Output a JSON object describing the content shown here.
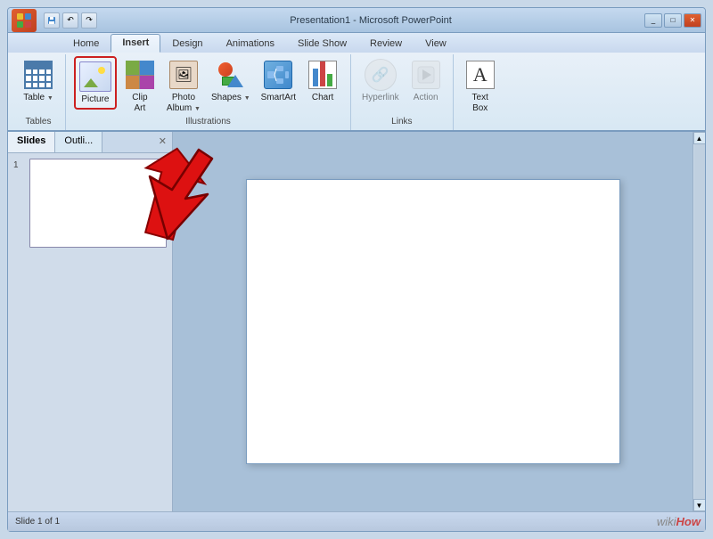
{
  "app": {
    "title": "Microsoft PowerPoint",
    "doc_title": "Presentation1 - Microsoft PowerPoint"
  },
  "title_bar": {
    "save_label": "💾",
    "undo_label": "↶",
    "redo_label": "↷"
  },
  "ribbon": {
    "tabs": [
      {
        "id": "home",
        "label": "Home"
      },
      {
        "id": "insert",
        "label": "Insert",
        "active": true
      },
      {
        "id": "design",
        "label": "Design"
      },
      {
        "id": "animations",
        "label": "Animations"
      },
      {
        "id": "slideshow",
        "label": "Slide Show"
      },
      {
        "id": "review",
        "label": "Review"
      },
      {
        "id": "view",
        "label": "View"
      }
    ],
    "groups": [
      {
        "id": "tables",
        "label": "Tables",
        "items": [
          {
            "id": "table",
            "label": "Table",
            "has_arrow": true
          }
        ]
      },
      {
        "id": "illustrations",
        "label": "Illustrations",
        "items": [
          {
            "id": "picture",
            "label": "Picture",
            "highlighted": true
          },
          {
            "id": "clip-art",
            "label": "Clip\nArt"
          },
          {
            "id": "photo-album",
            "label": "Photo\nAlbum",
            "has_arrow": true
          },
          {
            "id": "shapes",
            "label": "Shapes",
            "has_arrow": true
          },
          {
            "id": "smartart",
            "label": "SmartArt"
          },
          {
            "id": "chart",
            "label": "Chart"
          }
        ]
      },
      {
        "id": "links",
        "label": "Links",
        "items": [
          {
            "id": "hyperlink",
            "label": "Hyperlink",
            "disabled": true
          },
          {
            "id": "action",
            "label": "Action",
            "disabled": true
          }
        ]
      },
      {
        "id": "text",
        "label": "",
        "items": [
          {
            "id": "textbox",
            "label": "Text\nBox"
          }
        ]
      }
    ]
  },
  "slides_panel": {
    "tabs": [
      {
        "id": "slides",
        "label": "Slides",
        "active": true
      },
      {
        "id": "outline",
        "label": "Outli..."
      }
    ],
    "close_label": "✕",
    "slide_number": "1"
  },
  "status_bar": {
    "text": "Slide 1 of 1"
  },
  "wikihow": {
    "wiki": "wiki",
    "how": "How"
  }
}
